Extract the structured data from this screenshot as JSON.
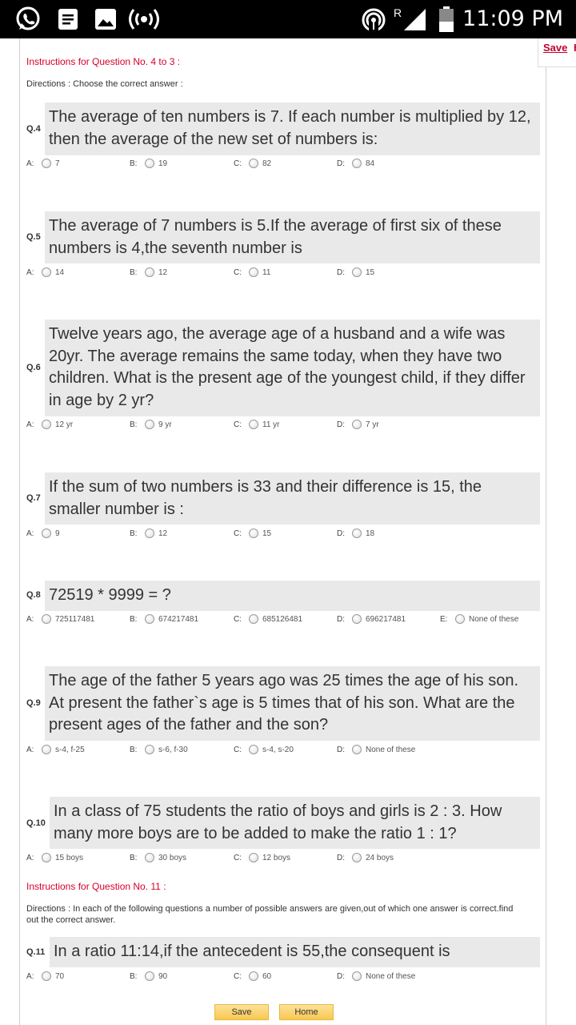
{
  "status_bar": {
    "left_icons": [
      "whatsapp-icon",
      "document-icon",
      "image-icon",
      "broadcast-icon"
    ],
    "right_icons": [
      "hotspot-icon",
      "signal-icon",
      "battery-icon"
    ],
    "roaming": "R",
    "time": "11:09 PM"
  },
  "sidebar": {
    "save_label": "Save",
    "next_label": "H"
  },
  "sections": [
    {
      "instruction": "Instructions for Question No. 4 to 3 :",
      "directions": "Directions : Choose the correct answer :"
    },
    {
      "instruction": "Instructions for Question No. 11 :",
      "directions": "Directions : In each of the following questions a number of possible answers are given,out of which one answer is correct.find out the correct answer."
    }
  ],
  "questions": [
    {
      "num": "Q.4",
      "text": "The average of ten numbers is 7. If each number is multiplied by 12, then the average of the new set of numbers is:",
      "options": [
        {
          "letter": "A:",
          "label": "7"
        },
        {
          "letter": "B:",
          "label": "19"
        },
        {
          "letter": "C:",
          "label": "82"
        },
        {
          "letter": "D:",
          "label": "84"
        }
      ]
    },
    {
      "num": "Q.5",
      "text": "The average of 7 numbers is 5.If the average of first six of these numbers is 4,the seventh number is",
      "options": [
        {
          "letter": "A:",
          "label": "14"
        },
        {
          "letter": "B:",
          "label": "12"
        },
        {
          "letter": "C:",
          "label": "11"
        },
        {
          "letter": "D:",
          "label": "15"
        }
      ]
    },
    {
      "num": "Q.6",
      "text": "Twelve years ago, the average age of a husband and a wife was 20yr. The average remains the same today, when they have two children. What is the present age of the youngest child, if they differ in age by 2 yr?",
      "options": [
        {
          "letter": "A:",
          "label": "12 yr"
        },
        {
          "letter": "B:",
          "label": "9 yr"
        },
        {
          "letter": "C:",
          "label": "11 yr"
        },
        {
          "letter": "D:",
          "label": "7 yr"
        }
      ]
    },
    {
      "num": "Q.7",
      "text": "If the sum of two numbers is 33 and their difference is 15, the smaller number is :",
      "options": [
        {
          "letter": "A:",
          "label": "9"
        },
        {
          "letter": "B:",
          "label": "12"
        },
        {
          "letter": "C:",
          "label": "15"
        },
        {
          "letter": "D:",
          "label": "18"
        }
      ]
    },
    {
      "num": "Q.8",
      "text": "72519 * 9999 = ?",
      "options": [
        {
          "letter": "A:",
          "label": "725117481"
        },
        {
          "letter": "B:",
          "label": "674217481"
        },
        {
          "letter": "C:",
          "label": "685126481"
        },
        {
          "letter": "D:",
          "label": "696217481"
        },
        {
          "letter": "E:",
          "label": "None of these"
        }
      ]
    },
    {
      "num": "Q.9",
      "text": "The age of the father 5 years ago was 25 times the age of his son. At present the father`s age is 5 times that of his son. What are the present ages of the father and the son?",
      "options": [
        {
          "letter": "A:",
          "label": "s-4, f-25"
        },
        {
          "letter": "B:",
          "label": "s-6, f-30"
        },
        {
          "letter": "C:",
          "label": "s-4, s-20"
        },
        {
          "letter": "D:",
          "label": "None of these"
        }
      ]
    },
    {
      "num": "Q.10",
      "text": "In a class of 75 students the ratio of boys and girls is 2 : 3. How many more boys are to be added to make the ratio 1 : 1?",
      "options": [
        {
          "letter": "A:",
          "label": "15 boys"
        },
        {
          "letter": "B:",
          "label": "30 boys"
        },
        {
          "letter": "C:",
          "label": "12 boys"
        },
        {
          "letter": "D:",
          "label": "24 boys"
        }
      ]
    },
    {
      "num": "Q.11",
      "text": "In a ratio 11:14,if the antecedent is 55,the consequent is",
      "options": [
        {
          "letter": "A:",
          "label": "70"
        },
        {
          "letter": "B:",
          "label": "90"
        },
        {
          "letter": "C:",
          "label": "60"
        },
        {
          "letter": "D:",
          "label": "None of these"
        }
      ]
    }
  ],
  "footer": {
    "save_label": "Save",
    "home_label": "Home"
  }
}
